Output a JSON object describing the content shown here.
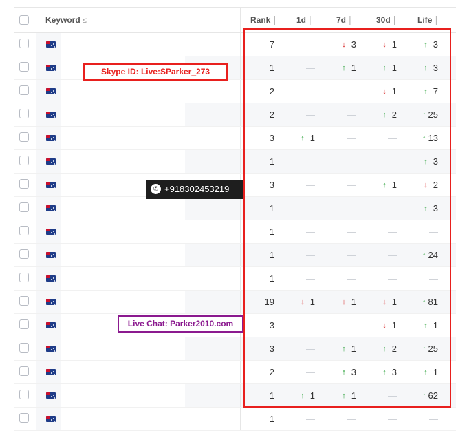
{
  "headers": {
    "keyword": "Keyword",
    "keyword_sort": "≤",
    "rank": "Rank",
    "d1": "1d",
    "d7": "7d",
    "d30": "30d",
    "life": "Life",
    "col_sort": "│"
  },
  "overlays": {
    "skype": "Skype ID: Live:SParker_273",
    "whatsapp": "+918302453219",
    "whatsapp_icon": "✆",
    "live_chat": "Live Chat: Parker2010.com"
  },
  "colors": {
    "up": "#1a9a2a",
    "down": "#d61f1f",
    "highlight": "#e8201e",
    "chat_border": "#8b1a8f"
  },
  "rows": [
    {
      "rank": "7",
      "d1": null,
      "d7": [
        "down",
        "3"
      ],
      "d30": [
        "down",
        "1"
      ],
      "life": [
        "up",
        "3"
      ]
    },
    {
      "rank": "1",
      "d1": null,
      "d7": [
        "up",
        "1"
      ],
      "d30": [
        "up",
        "1"
      ],
      "life": [
        "up",
        "3"
      ]
    },
    {
      "rank": "2",
      "d1": null,
      "d7": null,
      "d30": [
        "down",
        "1"
      ],
      "life": [
        "up",
        "7"
      ]
    },
    {
      "rank": "2",
      "d1": null,
      "d7": null,
      "d30": [
        "up",
        "2"
      ],
      "life": [
        "up",
        "25"
      ]
    },
    {
      "rank": "3",
      "d1": [
        "up",
        "1"
      ],
      "d7": null,
      "d30": null,
      "life": [
        "up",
        "13"
      ]
    },
    {
      "rank": "1",
      "d1": null,
      "d7": null,
      "d30": null,
      "life": [
        "up",
        "3"
      ]
    },
    {
      "rank": "3",
      "d1": null,
      "d7": null,
      "d30": [
        "up",
        "1"
      ],
      "life": [
        "down",
        "2"
      ]
    },
    {
      "rank": "1",
      "d1": null,
      "d7": null,
      "d30": null,
      "life": [
        "up",
        "3"
      ]
    },
    {
      "rank": "1",
      "d1": null,
      "d7": null,
      "d30": null,
      "life": null
    },
    {
      "rank": "1",
      "d1": null,
      "d7": null,
      "d30": null,
      "life": [
        "up",
        "24"
      ]
    },
    {
      "rank": "1",
      "d1": null,
      "d7": null,
      "d30": null,
      "life": null
    },
    {
      "rank": "19",
      "d1": [
        "down",
        "1"
      ],
      "d7": [
        "down",
        "1"
      ],
      "d30": [
        "down",
        "1"
      ],
      "life": [
        "up",
        "81"
      ]
    },
    {
      "rank": "3",
      "d1": null,
      "d7": null,
      "d30": [
        "down",
        "1"
      ],
      "life": [
        "up",
        "1"
      ]
    },
    {
      "rank": "3",
      "d1": null,
      "d7": [
        "up",
        "1"
      ],
      "d30": [
        "up",
        "2"
      ],
      "life": [
        "up",
        "25"
      ]
    },
    {
      "rank": "2",
      "d1": null,
      "d7": [
        "up",
        "3"
      ],
      "d30": [
        "up",
        "3"
      ],
      "life": [
        "up",
        "1"
      ]
    },
    {
      "rank": "1",
      "d1": [
        "up",
        "1"
      ],
      "d7": [
        "up",
        "1"
      ],
      "d30": null,
      "life": [
        "up",
        "62"
      ]
    },
    {
      "rank": "1",
      "d1": null,
      "d7": null,
      "d30": null,
      "life": null
    }
  ]
}
